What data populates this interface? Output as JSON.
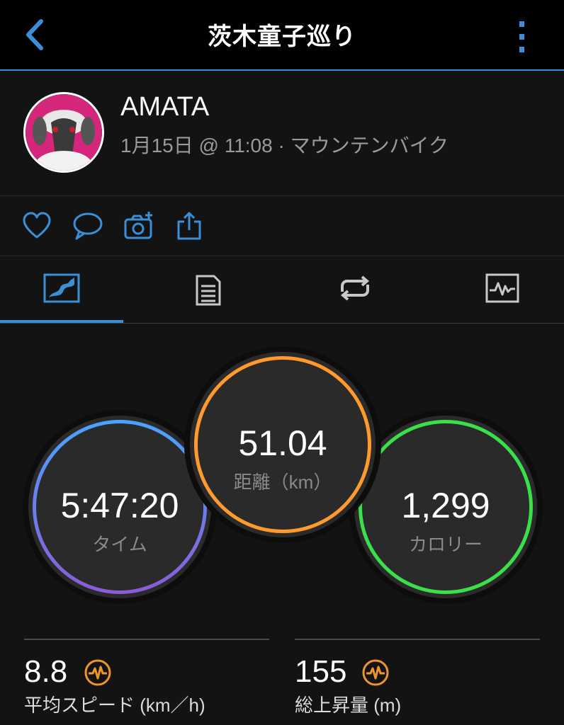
{
  "header": {
    "title": "茨木童子巡り",
    "back_icon": "chevron-left-icon",
    "menu_icon": "vertical-ellipsis-icon"
  },
  "profile": {
    "username": "AMATA",
    "meta": "1月15日 @ 11:08 · マウンテンバイク"
  },
  "actions": [
    {
      "icon": "heart-icon"
    },
    {
      "icon": "comment-icon"
    },
    {
      "icon": "add-photo-icon"
    },
    {
      "icon": "share-icon"
    }
  ],
  "tabs": [
    {
      "icon": "map-icon",
      "active": true
    },
    {
      "icon": "document-icon",
      "active": false
    },
    {
      "icon": "laps-icon",
      "active": false
    },
    {
      "icon": "graph-icon",
      "active": false
    }
  ],
  "stats": {
    "time": {
      "value": "5:47:20",
      "label": "タイム"
    },
    "distance": {
      "value": "51.04",
      "label": "距離（km）"
    },
    "calories": {
      "value": "1,299",
      "label": "カロリー"
    }
  },
  "metrics": {
    "avg_speed": {
      "value": "8.8",
      "label": "平均スピード (km／h)",
      "icon": "pulse-icon"
    },
    "elevation_gain": {
      "value": "155",
      "label": "総上昇量 (m)",
      "icon": "pulse-icon"
    }
  },
  "colors": {
    "accent": "#3b8fd6",
    "time_ring_top": "#4aa3ff",
    "time_ring_bottom": "#8a5cd6",
    "distance_ring": "#ff9a2e",
    "calories_ring": "#39e04a",
    "metric_icon": "#f0952a"
  }
}
